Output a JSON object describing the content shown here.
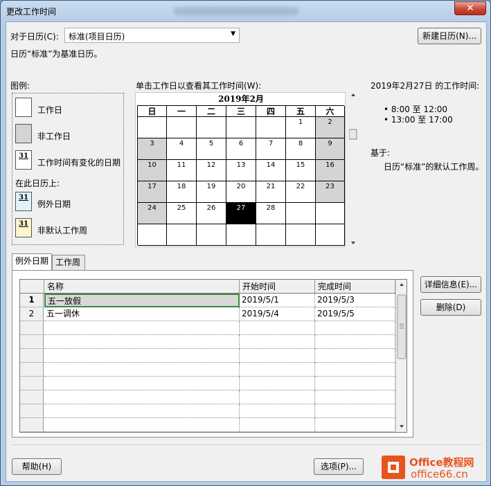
{
  "window": {
    "title": "更改工作时间",
    "close_label": "✕"
  },
  "calendar_select": {
    "label": "对于日历(C):",
    "value": "标准(项目日历)",
    "new_calendar_button": "新建日历(N)...",
    "base_note": "日历“标准”为基准日历。"
  },
  "legend": {
    "title": "图例:",
    "items": [
      {
        "label": "工作日",
        "swatch": "white"
      },
      {
        "label": "非工作日",
        "swatch": "gray"
      },
      {
        "label": "工作时间有变化的日期",
        "swatch": "31"
      }
    ],
    "on_this_calendar": "在此日历上:",
    "items2": [
      {
        "label": "例外日期",
        "swatch": "31"
      },
      {
        "label": "非默认工作周",
        "swatch": "31"
      }
    ]
  },
  "calendar": {
    "instruction": "单击工作日以查看其工作时间(W):",
    "month": "2019年2月",
    "weekdays": [
      "日",
      "一",
      "二",
      "三",
      "四",
      "五",
      "六"
    ],
    "weeks": [
      [
        "",
        "",
        "",
        "",
        "",
        "1",
        "2"
      ],
      [
        "3",
        "4",
        "5",
        "6",
        "7",
        "8",
        "9"
      ],
      [
        "10",
        "11",
        "12",
        "13",
        "14",
        "15",
        "16"
      ],
      [
        "17",
        "18",
        "19",
        "20",
        "21",
        "22",
        "23"
      ],
      [
        "24",
        "25",
        "26",
        "27",
        "28",
        "",
        ""
      ],
      [
        "",
        "",
        "",
        "",
        "",
        "",
        ""
      ]
    ],
    "selected_day": "27",
    "colors": {
      "nonwork": "#d4d4d4",
      "selected": "#000000"
    }
  },
  "work_time": {
    "heading": "2019年2月27日 的工作时间:",
    "slots": [
      "8:00 至 12:00",
      "13:00 至 17:00"
    ],
    "based_on_label": "基于:",
    "based_on_text": "日历“标准”的默认工作周。"
  },
  "tabs": [
    {
      "label": "例外日期",
      "active": true
    },
    {
      "label": "工作周",
      "active": false
    }
  ],
  "exceptions_table": {
    "columns": [
      "名称",
      "开始时间",
      "完成时间"
    ],
    "rows": [
      {
        "num": "1",
        "name": "五一放假",
        "start": "2019/5/1",
        "finish": "2019/5/3"
      },
      {
        "num": "2",
        "name": "五一调休",
        "start": "2019/5/4",
        "finish": "2019/5/5"
      }
    ]
  },
  "side_buttons": {
    "details": "详细信息(E)...",
    "delete": "删除(D)"
  },
  "footer": {
    "help": "帮助(H)",
    "options": "选项(P)..."
  },
  "watermark": {
    "brand_top": "Office教程网",
    "brand_bottom": "office66.cn",
    "accent": "#e8541e"
  }
}
